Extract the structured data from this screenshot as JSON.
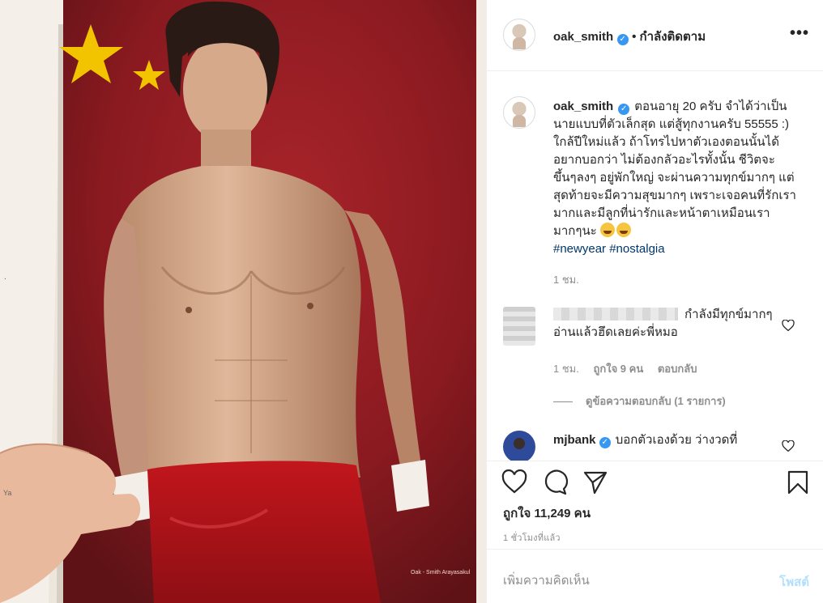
{
  "photo": {
    "credit": "Oak - Smith Arayasakul",
    "page_marks": [
      "Ya"
    ]
  },
  "header": {
    "username": "oak_smith",
    "follow_state": "• กำลังติดตาม",
    "more_icon": "more-horizontal-icon"
  },
  "caption": {
    "username": "oak_smith",
    "text": "ตอนอายุ 20 ครับ จำได้ว่าเป็นนายแบบที่ตัวเล็กสุด แต่สู้ทุกงานครับ 55555 :) ใกล้ปีใหม่แล้ว ถ้าโทรไปหาตัวเองตอนนั้นได้ อยากบอกว่า ไม่ต้องกลัวอะไรทั้งนั้น ชีวิตจะขึ้นๆลงๆ อยู่พักใหญ่ จะผ่านความทุกข์มากๆ แต่สุดท้ายจะมีความสุขมากๆ เพราะเจอคนที่รักเรามากและมีลูกที่น่ารักและหน้าตาเหมือนเรามากๆนะ",
    "hashtags": [
      "#newyear",
      "#nostalgia"
    ],
    "time": "1 ชม."
  },
  "comments": [
    {
      "username": "",
      "text": "กำลังมีทุกข์มากๆ อ่านแล้วฮึดเลยค่ะพี่หมอ",
      "time": "1 ชม.",
      "likes": "ถูกใจ 9 คน",
      "reply_label": "ตอบกลับ",
      "view_replies": "ดูข้อความตอบกลับ (1 รายการ)"
    },
    {
      "username": "mjbank",
      "text": "บอกตัวเองด้วย ว่างวดที่"
    }
  ],
  "actions": {
    "like_icon": "heart-icon",
    "comment_icon": "comment-icon",
    "share_icon": "send-icon",
    "save_icon": "bookmark-icon",
    "likes_text": "ถูกใจ 11,249 คน",
    "time_ago": "1 ชั่วโมงที่แล้ว"
  },
  "composer": {
    "placeholder": "เพิ่มความคิดเห็น",
    "post_label": "โพสต์"
  }
}
